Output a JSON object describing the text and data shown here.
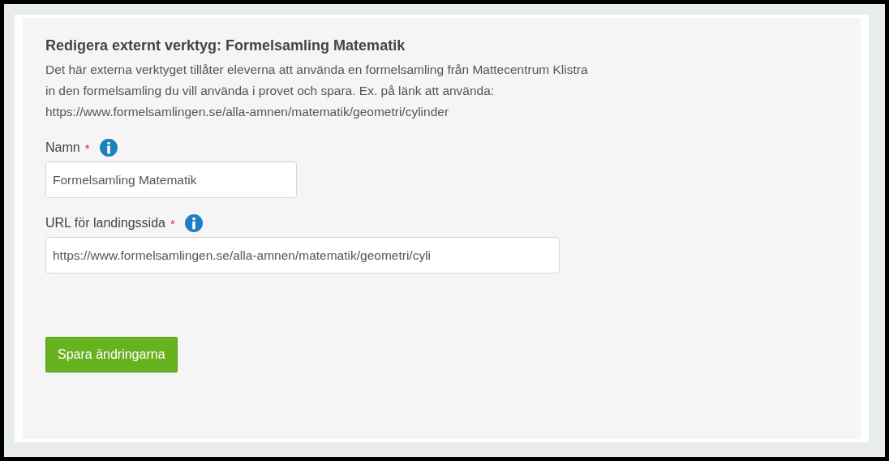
{
  "title": "Redigera externt verktyg: Formelsamling Matematik",
  "description": "Det här externa verktyget tillåter eleverna att använda en formelsamling från Mattecentrum Klistra in den formelsamling du vill använda i provet och spara. Ex. på länk att använda: https://www.formelsamlingen.se/alla-amnen/matematik/geometri/cylinder",
  "fields": [
    {
      "label": "Namn",
      "required_mark": "*",
      "value": "Formelsamling Matematik"
    },
    {
      "label": "URL för landingssida",
      "required_mark": "*",
      "value": "https://www.formelsamlingen.se/alla-amnen/matematik/geometri/cyli"
    }
  ],
  "button": "Spara ändringarna"
}
